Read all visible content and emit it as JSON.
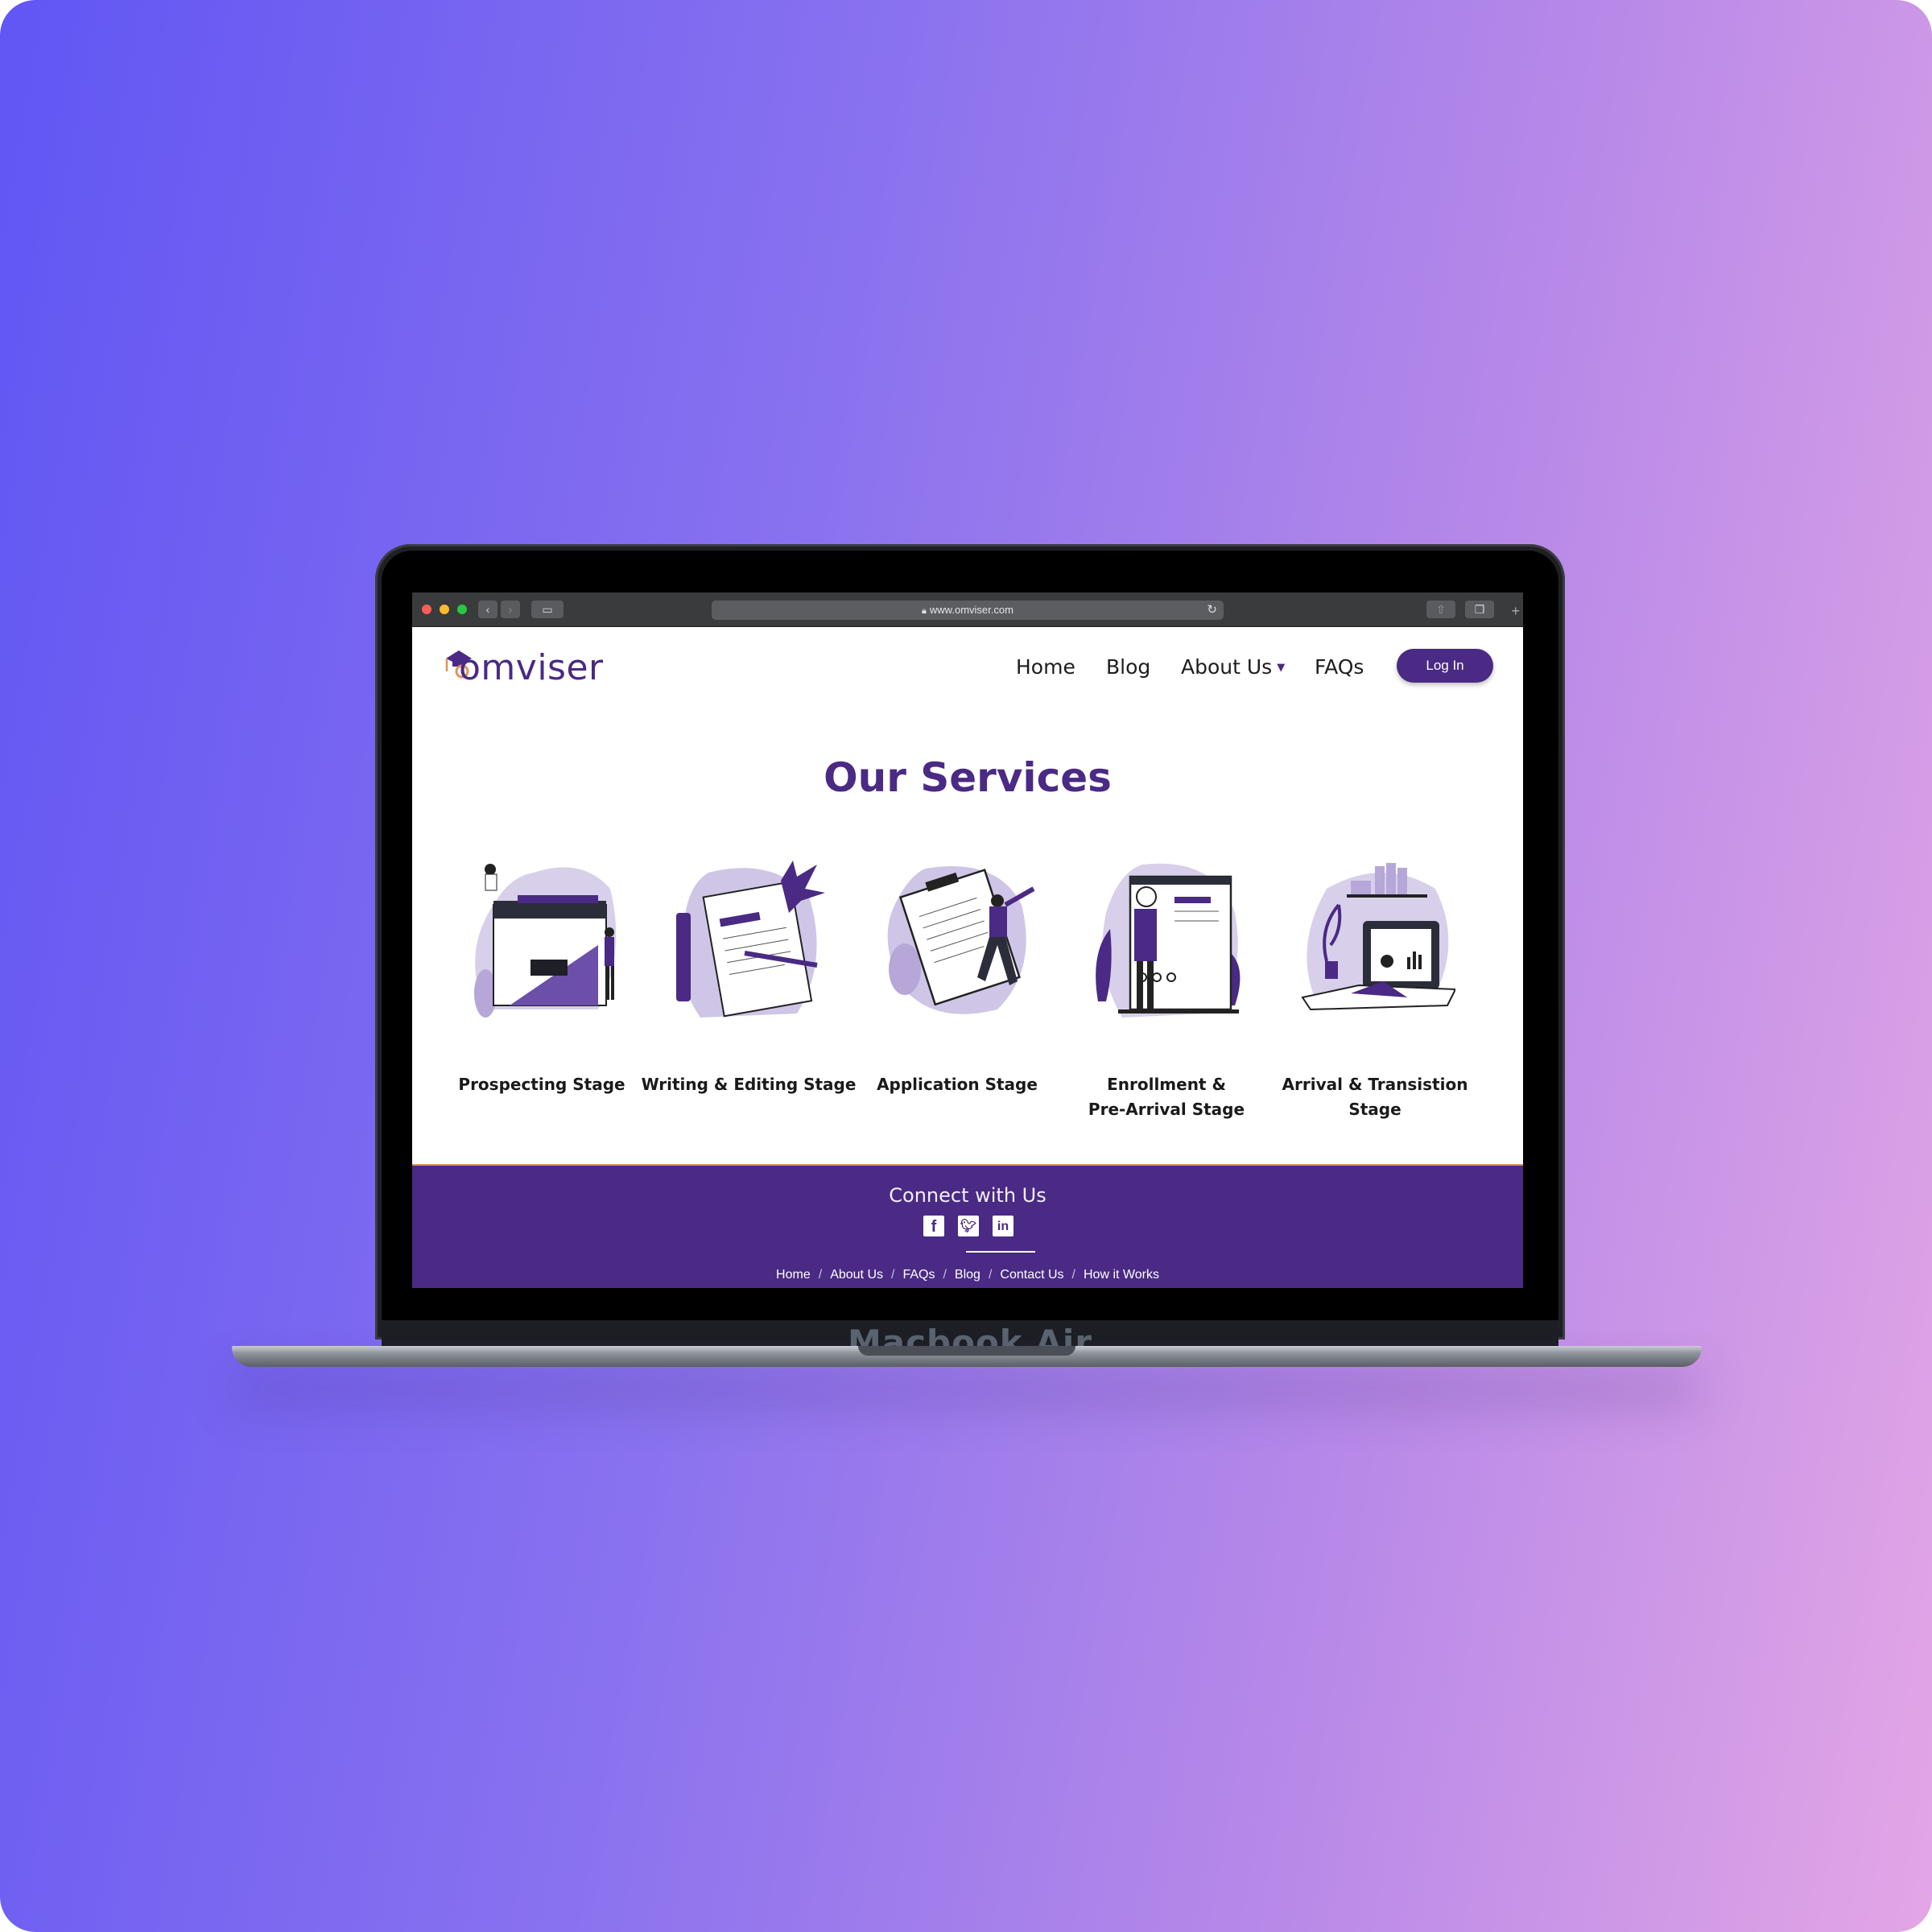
{
  "device": {
    "model_label": "Macbook Air"
  },
  "browser": {
    "url": "www.omviser.com"
  },
  "site": {
    "logo_text": "omviser",
    "nav": {
      "home": "Home",
      "blog": "Blog",
      "about": "About Us",
      "faqs": "FAQs",
      "login": "Log In"
    },
    "heading": "Our Services",
    "services": [
      {
        "label": "Prospecting Stage"
      },
      {
        "label": "Writing & Editing Stage"
      },
      {
        "label": "Application Stage"
      },
      {
        "label": "Enrollment &\nPre-Arrival Stage"
      },
      {
        "label": "Arrival & Transistion Stage"
      }
    ],
    "footer": {
      "connect": "Connect with Us",
      "links": [
        "Home",
        "About Us",
        "FAQs",
        "Blog",
        "Contact Us",
        "How it Works"
      ],
      "separator": "/"
    }
  },
  "colors": {
    "brand": "#4a2a84",
    "accent": "#e0925a",
    "light_purple": "#c9bde4"
  },
  "icons": [
    "lock-icon",
    "reload-icon",
    "back-icon",
    "forward-icon",
    "sidebar-icon",
    "share-icon",
    "tabs-icon",
    "facebook-icon",
    "twitter-icon",
    "linkedin-icon",
    "caret-down-icon"
  ]
}
